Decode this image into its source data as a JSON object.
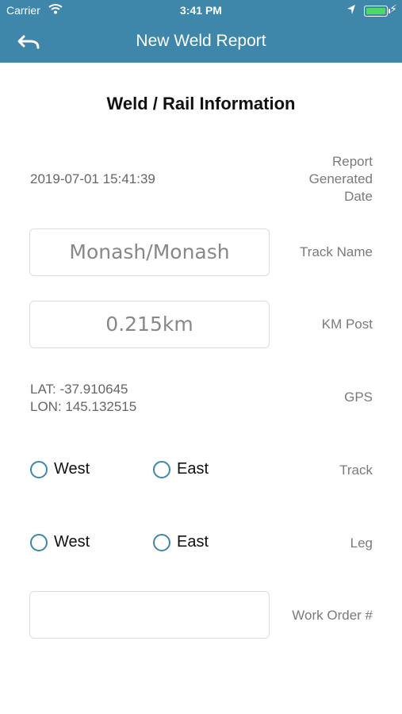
{
  "status_bar": {
    "carrier": "Carrier",
    "time": "3:41 PM",
    "bolt": "⚡"
  },
  "header": {
    "title": "New Weld Report",
    "back_icon": "undo-icon"
  },
  "section": {
    "title": "Weld / Rail Information"
  },
  "report_date": {
    "value": "2019-07-01 15:41:39",
    "label_lines": [
      "Report",
      "Generated",
      "Date"
    ]
  },
  "track_name": {
    "value": "Monash/Monash",
    "label": "Track Name"
  },
  "km_post": {
    "value": "0.215km",
    "label": "KM Post"
  },
  "gps": {
    "lat": "LAT: -37.910645",
    "lon": "LON: 145.132515",
    "label": "GPS"
  },
  "track": {
    "label": "Track",
    "options": [
      "West",
      "East"
    ]
  },
  "leg": {
    "label": "Leg",
    "options": [
      "West",
      "East"
    ]
  },
  "work_order": {
    "value": "",
    "label": "Work Order #"
  },
  "colors": {
    "header": "#3f86ab",
    "radio": "#3f86ab",
    "battery": "#4cd964"
  }
}
